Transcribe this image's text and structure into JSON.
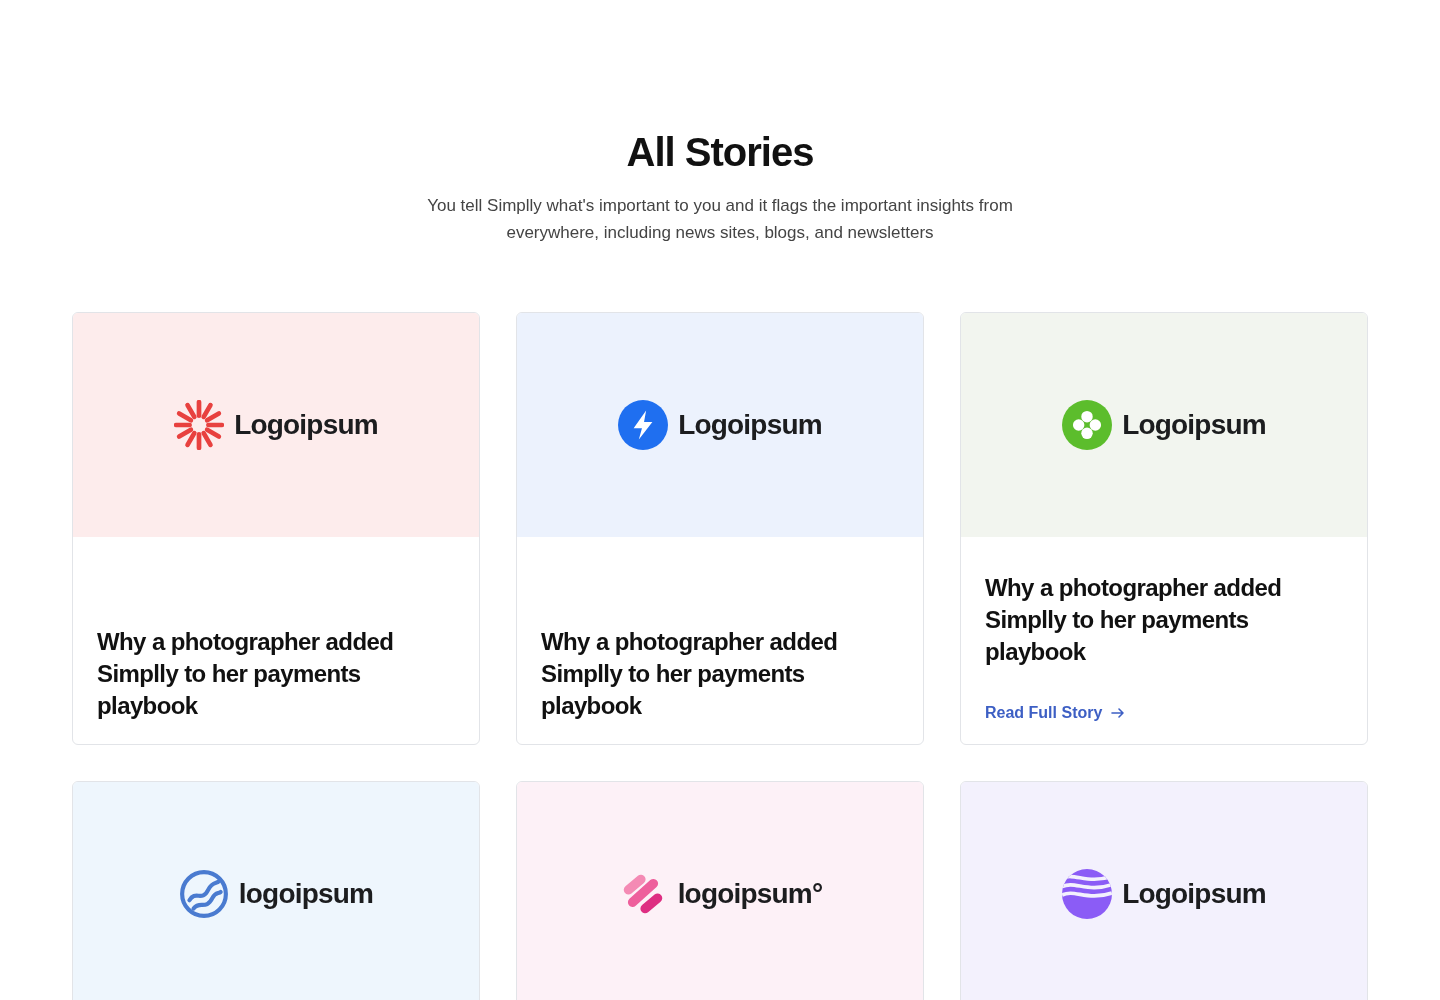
{
  "header": {
    "title": "All Stories",
    "subtitle": "You tell Simplly what's important to you and it flags the important insights from everywhere, including news sites, blogs, and newsletters"
  },
  "stories": [
    {
      "color": "#fdecec",
      "logo": {
        "kind": "sunburst",
        "text": "Logoipsum"
      },
      "title": "Why a photographer added Simplly to her payments playbook"
    },
    {
      "color": "#ecf2fd",
      "logo": {
        "kind": "bolt",
        "text": "Logoipsum"
      },
      "title": "Why a photographer added Simplly to her payments playbook"
    },
    {
      "color": "#f2f5ef",
      "logo": {
        "kind": "clover",
        "text": "Logoipsum"
      },
      "title": "Why a photographer added Simplly to her payments playbook",
      "link": "Read Full Story"
    },
    {
      "color": "#eef6fd",
      "logo": {
        "kind": "swirl",
        "text": "logoipsum"
      }
    },
    {
      "color": "#fdf1f7",
      "logo": {
        "kind": "molecule",
        "text": "logoipsum°"
      }
    },
    {
      "color": "#f3f1fd",
      "logo": {
        "kind": "sphere",
        "text": "Logoipsum"
      }
    }
  ]
}
